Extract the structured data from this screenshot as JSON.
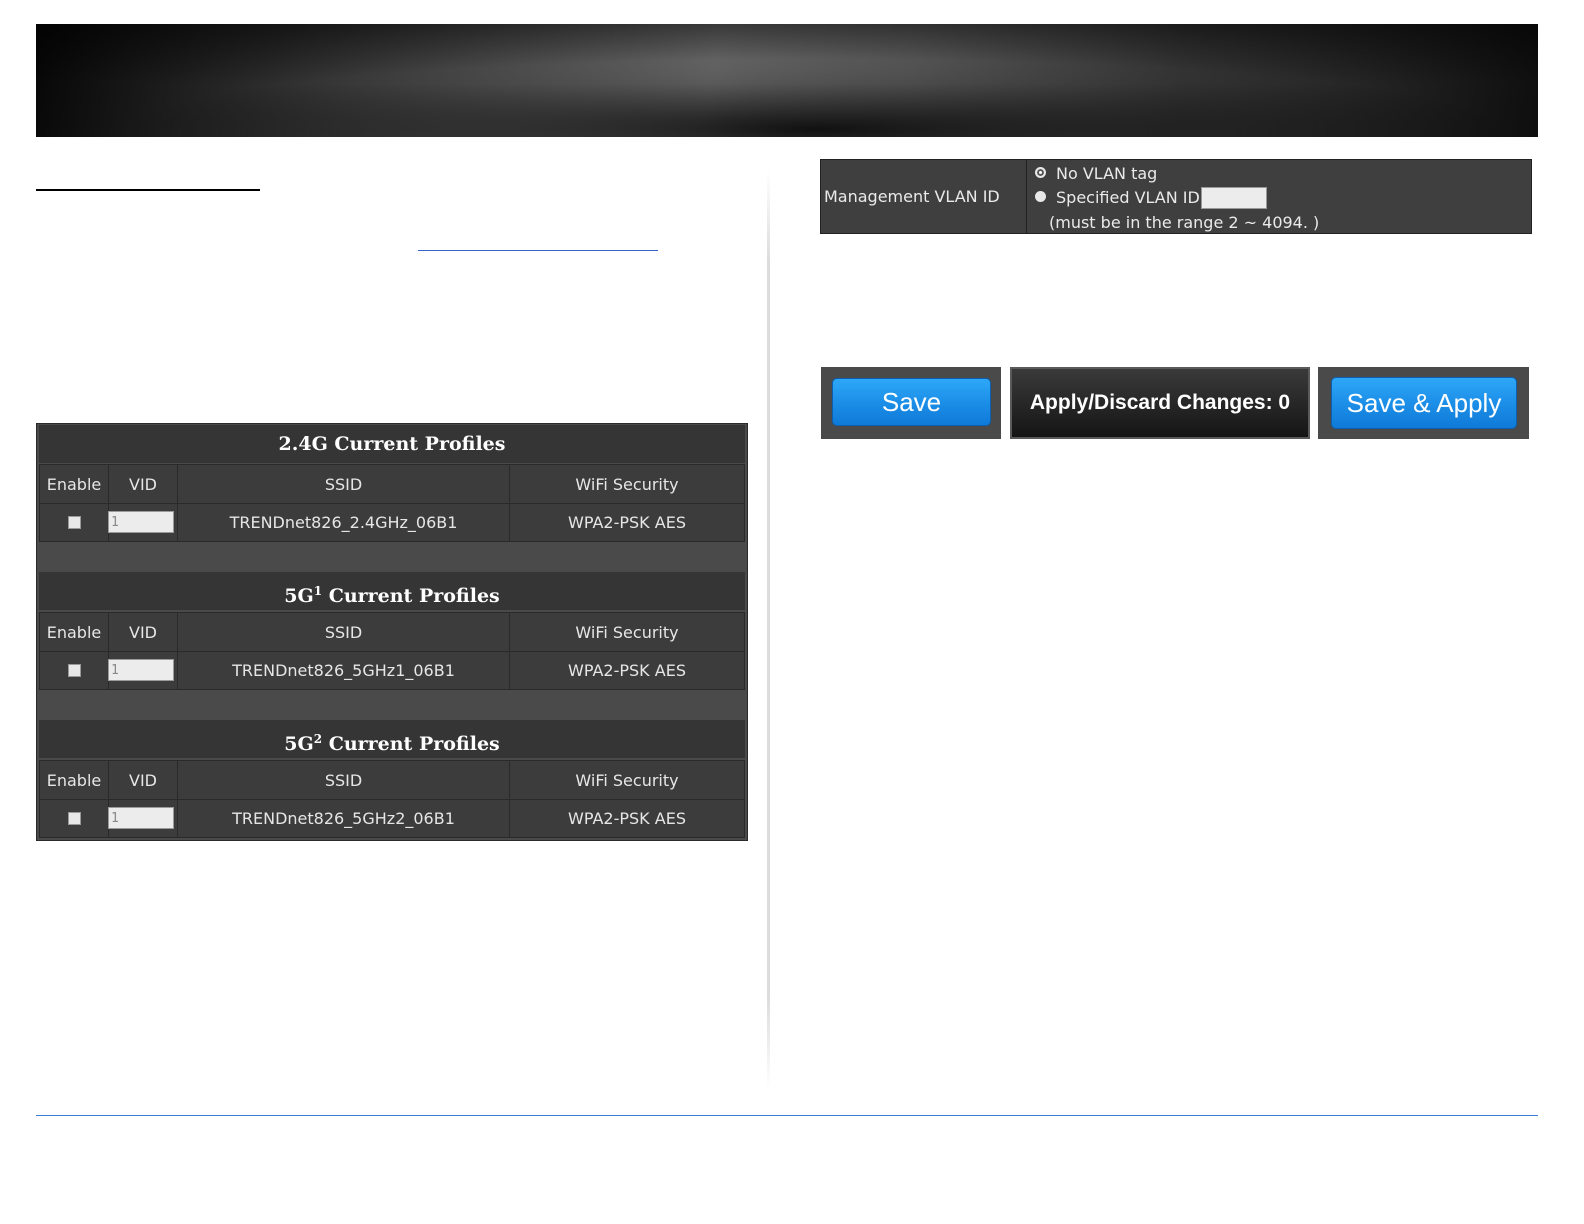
{
  "profiles": [
    {
      "title": "2.4G Current Profiles",
      "title_sup": "",
      "headers": [
        "Enable",
        "VID",
        "SSID",
        "WiFi Security"
      ],
      "row": {
        "vid": "1",
        "ssid": "TRENDnet826_2.4GHz_06B1",
        "security": "WPA2-PSK AES"
      }
    },
    {
      "title": "5G",
      "title_sup": "1",
      "title_rest": " Current Profiles",
      "headers": [
        "Enable",
        "VID",
        "SSID",
        "WiFi Security"
      ],
      "row": {
        "vid": "1",
        "ssid": "TRENDnet826_5GHz1_06B1",
        "security": "WPA2-PSK AES"
      }
    },
    {
      "title": "5G",
      "title_sup": "2",
      "title_rest": " Current Profiles",
      "headers": [
        "Enable",
        "VID",
        "SSID",
        "WiFi Security"
      ],
      "row": {
        "vid": "1",
        "ssid": "TRENDnet826_5GHz2_06B1",
        "security": "WPA2-PSK AES"
      }
    }
  ],
  "vlan": {
    "label": "Management VLAN ID",
    "option_no_tag": "No VLAN tag",
    "option_specified": "Specified VLAN ID",
    "range_note": "(must be in the range 2 ~ 4094. )"
  },
  "buttons": {
    "save": "Save",
    "apply_discard": "Apply/Discard Changes: 0",
    "save_apply": "Save & Apply"
  },
  "colors": {
    "button_blue": "#1c8fe8",
    "panel_dark": "#3c3c3c",
    "footer_line": "#3a7bd5"
  }
}
